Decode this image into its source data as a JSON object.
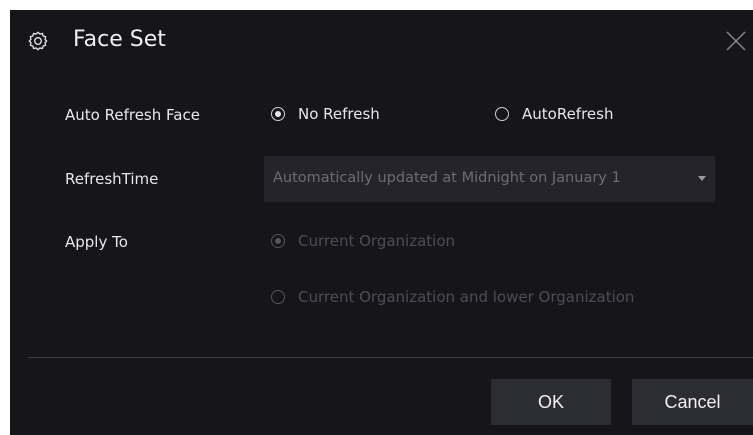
{
  "dialog": {
    "title": "Face Set",
    "title_icon": "gear-icon",
    "close_icon": "close-icon"
  },
  "auto_refresh": {
    "label": "Auto Refresh Face",
    "options": [
      {
        "label": "No Refresh",
        "checked": true
      },
      {
        "label": "AutoRefresh",
        "checked": false
      }
    ]
  },
  "refresh_time": {
    "label": "RefreshTime",
    "value": "Automatically updated at Midnight on January 1",
    "caret_icon": "caret-down-icon"
  },
  "apply_to": {
    "label": "Apply To",
    "options": [
      {
        "label": "Current Organization",
        "checked": true,
        "disabled": true
      },
      {
        "label": "Current Organization and lower Organization",
        "checked": false,
        "disabled": true
      }
    ]
  },
  "footer": {
    "ok_label": "OK",
    "cancel_label": "Cancel"
  }
}
